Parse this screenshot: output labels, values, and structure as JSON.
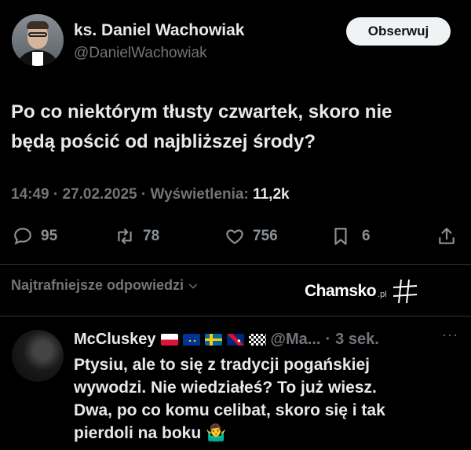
{
  "author": {
    "name": "ks. Daniel Wachowiak",
    "handle": "@DanielWachowiak",
    "follow_label": "Obserwuj"
  },
  "tweet": {
    "line1": "Po co niektórym tłusty czwartek, skoro nie",
    "line2": "będą pościć od najbliższej środy?",
    "time": "14:49",
    "date": "27.02.2025",
    "views_label": "Wyświetlenia:",
    "views_value": "11,2k",
    "sep": "·"
  },
  "actions": {
    "replies": "95",
    "retweets": "78",
    "likes": "756",
    "bookmarks": "6"
  },
  "sort": {
    "label": "Najtrafniejsze odpowiedzi"
  },
  "watermark": {
    "text": "Chamsko",
    "suffix": ".pl"
  },
  "reply": {
    "name": "McCluskey",
    "handle": "@Ma...",
    "time": "3 sek.",
    "sep": "·",
    "line1": "Ptysiu, ale to się z tradycji pogańskiej",
    "line2": "wywodzi. Nie wiedziałeś? To już wiesz.",
    "line3": "Dwa, po co komu celibat, skoro się i tak",
    "line4": "pierdoli na boku",
    "emoji": "🤷‍♂️",
    "more": "···"
  },
  "colors": {
    "background": "#000000",
    "text": "#e7e9ea",
    "muted": "#71767b",
    "follow_bg": "#eff3f4"
  }
}
